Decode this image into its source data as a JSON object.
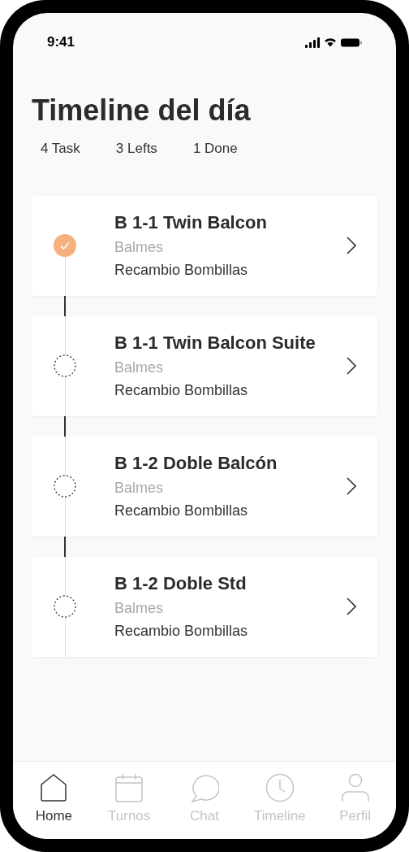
{
  "status_bar": {
    "time": "9:41"
  },
  "title": "Timeline del día",
  "stats": [
    "4 Task",
    "3 Lefts",
    "1 Done"
  ],
  "tasks": [
    {
      "title": "B 1-1 Twin Balcon",
      "location": "Balmes",
      "description": "Recambio Bombillas",
      "done": true
    },
    {
      "title": "B 1-1 Twin Balcon Suite",
      "location": "Balmes",
      "description": "Recambio Bombillas",
      "done": false
    },
    {
      "title": "B 1-2 Doble Balcón",
      "location": "Balmes",
      "description": "Recambio Bombillas",
      "done": false
    },
    {
      "title": "B 1-2 Doble Std",
      "location": "Balmes",
      "description": "Recambio Bombillas",
      "done": false
    }
  ],
  "tab_bar": [
    {
      "label": "Home",
      "kind": "home",
      "selected": true
    },
    {
      "label": "Turnos",
      "kind": "calendar",
      "selected": false
    },
    {
      "label": "Chat",
      "kind": "chat",
      "selected": false
    },
    {
      "label": "Timeline",
      "kind": "clock",
      "selected": false
    },
    {
      "label": "Perfil",
      "kind": "user",
      "selected": false
    }
  ]
}
